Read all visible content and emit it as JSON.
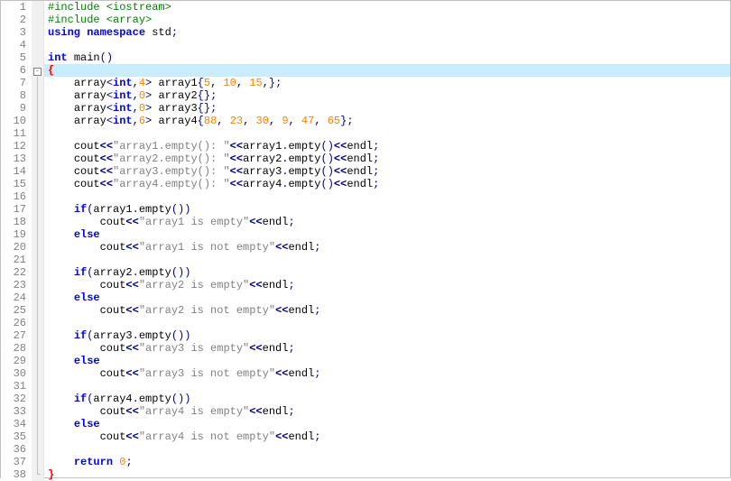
{
  "colors": {
    "highlight_bg": "#c7edff",
    "gutter_fg": "#808080",
    "preprocessor": "#008000",
    "keyword": "#0000ff",
    "number": "#ff8000",
    "string": "#808080",
    "brace": "#ff0000",
    "punct": "#000080"
  },
  "fold_markers": {
    "line6": "minus",
    "line38": "end"
  },
  "highlighted_line": 6,
  "lines": [
    {
      "n": 1,
      "indent": 0,
      "tokens": [
        [
          "prep",
          "#include <iostream>"
        ]
      ]
    },
    {
      "n": 2,
      "indent": 0,
      "tokens": [
        [
          "prep",
          "#include <array>"
        ]
      ]
    },
    {
      "n": 3,
      "indent": 0,
      "tokens": [
        [
          "kw",
          "using"
        ],
        [
          "sp",
          " "
        ],
        [
          "kw",
          "namespace"
        ],
        [
          "sp",
          " "
        ],
        [
          "ident",
          "std"
        ],
        [
          "punc",
          ";"
        ]
      ]
    },
    {
      "n": 4,
      "indent": 0,
      "tokens": []
    },
    {
      "n": 5,
      "indent": 0,
      "tokens": [
        [
          "kw",
          "int"
        ],
        [
          "sp",
          " "
        ],
        [
          "ident",
          "main"
        ],
        [
          "punc",
          "()"
        ]
      ]
    },
    {
      "n": 6,
      "indent": 0,
      "tokens": [
        [
          "brace",
          "{"
        ]
      ]
    },
    {
      "n": 7,
      "indent": 2,
      "tokens": [
        [
          "ident",
          "array"
        ],
        [
          "punc",
          "<"
        ],
        [
          "kw",
          "int"
        ],
        [
          "punc",
          ","
        ],
        [
          "num",
          "4"
        ],
        [
          "punc",
          ">"
        ],
        [
          "sp",
          " "
        ],
        [
          "ident",
          "array1"
        ],
        [
          "punc",
          "{"
        ],
        [
          "num",
          "5"
        ],
        [
          "punc",
          ","
        ],
        [
          "sp",
          " "
        ],
        [
          "num",
          "10"
        ],
        [
          "punc",
          ","
        ],
        [
          "sp",
          " "
        ],
        [
          "num",
          "15"
        ],
        [
          "punc",
          ",};"
        ]
      ]
    },
    {
      "n": 8,
      "indent": 2,
      "tokens": [
        [
          "ident",
          "array"
        ],
        [
          "punc",
          "<"
        ],
        [
          "kw",
          "int"
        ],
        [
          "punc",
          ","
        ],
        [
          "num",
          "0"
        ],
        [
          "punc",
          ">"
        ],
        [
          "sp",
          " "
        ],
        [
          "ident",
          "array2"
        ],
        [
          "punc",
          "{};"
        ]
      ]
    },
    {
      "n": 9,
      "indent": 2,
      "tokens": [
        [
          "ident",
          "array"
        ],
        [
          "punc",
          "<"
        ],
        [
          "kw",
          "int"
        ],
        [
          "punc",
          ","
        ],
        [
          "num",
          "0"
        ],
        [
          "punc",
          ">"
        ],
        [
          "sp",
          " "
        ],
        [
          "ident",
          "array3"
        ],
        [
          "punc",
          "{};"
        ]
      ]
    },
    {
      "n": 10,
      "indent": 2,
      "tokens": [
        [
          "ident",
          "array"
        ],
        [
          "punc",
          "<"
        ],
        [
          "kw",
          "int"
        ],
        [
          "punc",
          ","
        ],
        [
          "num",
          "6"
        ],
        [
          "punc",
          ">"
        ],
        [
          "sp",
          " "
        ],
        [
          "ident",
          "array4"
        ],
        [
          "punc",
          "{"
        ],
        [
          "num",
          "88"
        ],
        [
          "punc",
          ","
        ],
        [
          "sp",
          " "
        ],
        [
          "num",
          "23"
        ],
        [
          "punc",
          ","
        ],
        [
          "sp",
          " "
        ],
        [
          "num",
          "30"
        ],
        [
          "punc",
          ","
        ],
        [
          "sp",
          " "
        ],
        [
          "num",
          "9"
        ],
        [
          "punc",
          ","
        ],
        [
          "sp",
          " "
        ],
        [
          "num",
          "47"
        ],
        [
          "punc",
          ","
        ],
        [
          "sp",
          " "
        ],
        [
          "num",
          "65"
        ],
        [
          "punc",
          "};"
        ]
      ]
    },
    {
      "n": 11,
      "indent": 0,
      "tokens": []
    },
    {
      "n": 12,
      "indent": 2,
      "tokens": [
        [
          "ident",
          "cout"
        ],
        [
          "op",
          "<<"
        ],
        [
          "str",
          "\"array1.empty(): \""
        ],
        [
          "op",
          "<<"
        ],
        [
          "ident",
          "array1"
        ],
        [
          "punc",
          "."
        ],
        [
          "ident",
          "empty"
        ],
        [
          "punc",
          "()"
        ],
        [
          "op",
          "<<"
        ],
        [
          "ident",
          "endl"
        ],
        [
          "punc",
          ";"
        ]
      ]
    },
    {
      "n": 13,
      "indent": 2,
      "tokens": [
        [
          "ident",
          "cout"
        ],
        [
          "op",
          "<<"
        ],
        [
          "str",
          "\"array2.empty(): \""
        ],
        [
          "op",
          "<<"
        ],
        [
          "ident",
          "array2"
        ],
        [
          "punc",
          "."
        ],
        [
          "ident",
          "empty"
        ],
        [
          "punc",
          "()"
        ],
        [
          "op",
          "<<"
        ],
        [
          "ident",
          "endl"
        ],
        [
          "punc",
          ";"
        ]
      ]
    },
    {
      "n": 14,
      "indent": 2,
      "tokens": [
        [
          "ident",
          "cout"
        ],
        [
          "op",
          "<<"
        ],
        [
          "str",
          "\"array3.empty(): \""
        ],
        [
          "op",
          "<<"
        ],
        [
          "ident",
          "array3"
        ],
        [
          "punc",
          "."
        ],
        [
          "ident",
          "empty"
        ],
        [
          "punc",
          "()"
        ],
        [
          "op",
          "<<"
        ],
        [
          "ident",
          "endl"
        ],
        [
          "punc",
          ";"
        ]
      ]
    },
    {
      "n": 15,
      "indent": 2,
      "tokens": [
        [
          "ident",
          "cout"
        ],
        [
          "op",
          "<<"
        ],
        [
          "str",
          "\"array4.empty(): \""
        ],
        [
          "op",
          "<<"
        ],
        [
          "ident",
          "array4"
        ],
        [
          "punc",
          "."
        ],
        [
          "ident",
          "empty"
        ],
        [
          "punc",
          "()"
        ],
        [
          "op",
          "<<"
        ],
        [
          "ident",
          "endl"
        ],
        [
          "punc",
          ";"
        ]
      ]
    },
    {
      "n": 16,
      "indent": 0,
      "tokens": []
    },
    {
      "n": 17,
      "indent": 2,
      "tokens": [
        [
          "kw",
          "if"
        ],
        [
          "punc",
          "("
        ],
        [
          "ident",
          "array1"
        ],
        [
          "punc",
          "."
        ],
        [
          "ident",
          "empty"
        ],
        [
          "punc",
          "())"
        ]
      ]
    },
    {
      "n": 18,
      "indent": 3,
      "tokens": [
        [
          "ident",
          "cout"
        ],
        [
          "op",
          "<<"
        ],
        [
          "str",
          "\"array1 is empty\""
        ],
        [
          "op",
          "<<"
        ],
        [
          "ident",
          "endl"
        ],
        [
          "punc",
          ";"
        ]
      ]
    },
    {
      "n": 19,
      "indent": 2,
      "tokens": [
        [
          "kw",
          "else"
        ]
      ]
    },
    {
      "n": 20,
      "indent": 3,
      "tokens": [
        [
          "ident",
          "cout"
        ],
        [
          "op",
          "<<"
        ],
        [
          "str",
          "\"array1 is not empty\""
        ],
        [
          "op",
          "<<"
        ],
        [
          "ident",
          "endl"
        ],
        [
          "punc",
          ";"
        ]
      ]
    },
    {
      "n": 21,
      "indent": 0,
      "tokens": []
    },
    {
      "n": 22,
      "indent": 2,
      "tokens": [
        [
          "kw",
          "if"
        ],
        [
          "punc",
          "("
        ],
        [
          "ident",
          "array2"
        ],
        [
          "punc",
          "."
        ],
        [
          "ident",
          "empty"
        ],
        [
          "punc",
          "())"
        ]
      ]
    },
    {
      "n": 23,
      "indent": 3,
      "tokens": [
        [
          "ident",
          "cout"
        ],
        [
          "op",
          "<<"
        ],
        [
          "str",
          "\"array2 is empty\""
        ],
        [
          "op",
          "<<"
        ],
        [
          "ident",
          "endl"
        ],
        [
          "punc",
          ";"
        ]
      ]
    },
    {
      "n": 24,
      "indent": 2,
      "tokens": [
        [
          "kw",
          "else"
        ]
      ]
    },
    {
      "n": 25,
      "indent": 3,
      "tokens": [
        [
          "ident",
          "cout"
        ],
        [
          "op",
          "<<"
        ],
        [
          "str",
          "\"array2 is not empty\""
        ],
        [
          "op",
          "<<"
        ],
        [
          "ident",
          "endl"
        ],
        [
          "punc",
          ";"
        ]
      ]
    },
    {
      "n": 26,
      "indent": 0,
      "tokens": []
    },
    {
      "n": 27,
      "indent": 2,
      "tokens": [
        [
          "kw",
          "if"
        ],
        [
          "punc",
          "("
        ],
        [
          "ident",
          "array3"
        ],
        [
          "punc",
          "."
        ],
        [
          "ident",
          "empty"
        ],
        [
          "punc",
          "())"
        ]
      ]
    },
    {
      "n": 28,
      "indent": 3,
      "tokens": [
        [
          "ident",
          "cout"
        ],
        [
          "op",
          "<<"
        ],
        [
          "str",
          "\"array3 is empty\""
        ],
        [
          "op",
          "<<"
        ],
        [
          "ident",
          "endl"
        ],
        [
          "punc",
          ";"
        ]
      ]
    },
    {
      "n": 29,
      "indent": 2,
      "tokens": [
        [
          "kw",
          "else"
        ]
      ]
    },
    {
      "n": 30,
      "indent": 3,
      "tokens": [
        [
          "ident",
          "cout"
        ],
        [
          "op",
          "<<"
        ],
        [
          "str",
          "\"array3 is not empty\""
        ],
        [
          "op",
          "<<"
        ],
        [
          "ident",
          "endl"
        ],
        [
          "punc",
          ";"
        ]
      ]
    },
    {
      "n": 31,
      "indent": 0,
      "tokens": []
    },
    {
      "n": 32,
      "indent": 2,
      "tokens": [
        [
          "kw",
          "if"
        ],
        [
          "punc",
          "("
        ],
        [
          "ident",
          "array4"
        ],
        [
          "punc",
          "."
        ],
        [
          "ident",
          "empty"
        ],
        [
          "punc",
          "())"
        ]
      ]
    },
    {
      "n": 33,
      "indent": 3,
      "tokens": [
        [
          "ident",
          "cout"
        ],
        [
          "op",
          "<<"
        ],
        [
          "str",
          "\"array4 is empty\""
        ],
        [
          "op",
          "<<"
        ],
        [
          "ident",
          "endl"
        ],
        [
          "punc",
          ";"
        ]
      ]
    },
    {
      "n": 34,
      "indent": 2,
      "tokens": [
        [
          "kw",
          "else"
        ]
      ]
    },
    {
      "n": 35,
      "indent": 3,
      "tokens": [
        [
          "ident",
          "cout"
        ],
        [
          "op",
          "<<"
        ],
        [
          "str",
          "\"array4 is not empty\""
        ],
        [
          "op",
          "<<"
        ],
        [
          "ident",
          "endl"
        ],
        [
          "punc",
          ";"
        ]
      ]
    },
    {
      "n": 36,
      "indent": 0,
      "tokens": []
    },
    {
      "n": 37,
      "indent": 2,
      "tokens": [
        [
          "kw",
          "return"
        ],
        [
          "sp",
          " "
        ],
        [
          "num",
          "0"
        ],
        [
          "punc",
          ";"
        ]
      ]
    },
    {
      "n": 38,
      "indent": 0,
      "tokens": [
        [
          "brace",
          "}"
        ]
      ]
    }
  ]
}
